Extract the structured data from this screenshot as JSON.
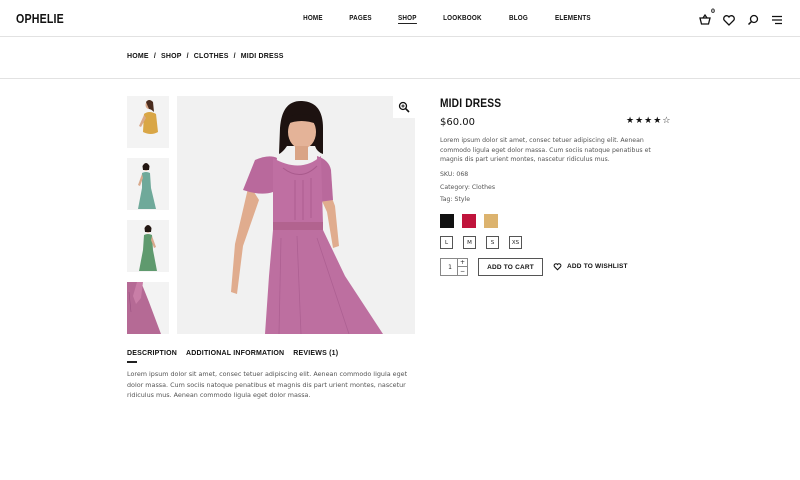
{
  "header": {
    "logo": "OPHELIE",
    "nav": [
      "HOME",
      "PAGES",
      "SHOP",
      "LOOKBOOK",
      "BLOG",
      "ELEMENTS"
    ],
    "active_nav": "SHOP",
    "cart_count": "0",
    "icons": [
      "cart-icon",
      "heart-icon",
      "search-icon",
      "menu-icon"
    ]
  },
  "breadcrumb": {
    "items": [
      "HOME",
      "SHOP",
      "CLOTHES",
      "MIDI DRESS"
    ],
    "separator": "/"
  },
  "gallery": {
    "thumbnails": [
      "mustard-top-thumbnail",
      "teal-dress-thumbnail",
      "green-dress-thumbnail",
      "pink-dress-detail-thumbnail"
    ],
    "main_image": "pink-midi-dress-image",
    "zoom_icon": "zoom-in-icon"
  },
  "product": {
    "title": "MIDI DRESS",
    "price": "$60.00",
    "rating": 4,
    "rating_max": 5,
    "description": "Lorem ipsum dolor sit amet, consec tetuer adipiscing elit. Aenean commodo ligula eget dolor massa. Cum sociis natoque penatibus et magnis dis part urient montes, nascetur ridiculus mus.",
    "sku": "SKU: 068",
    "category": "Category: Clothes",
    "tag": "Tag: Style",
    "colors": [
      "#111111",
      "#c0143c",
      "#dcb36e"
    ],
    "sizes": [
      "L",
      "M",
      "S",
      "XS"
    ],
    "quantity": "1",
    "add_to_cart": "ADD TO CART",
    "wishlist": "ADD TO WISHLIST"
  },
  "tabs": {
    "items": [
      "DESCRIPTION",
      "ADDITIONAL INFORMATION",
      "REVIEWS (1)"
    ],
    "active": "DESCRIPTION",
    "content": "Lorem ipsum dolor sit amet, consec tetuer adipiscing elit. Aenean commodo ligula eget dolor massa. Cum sociis natoque penatibus et magnis dis part urient montes, nascetur ridiculus mus. Aenean commodo ligula eget dolor massa."
  }
}
